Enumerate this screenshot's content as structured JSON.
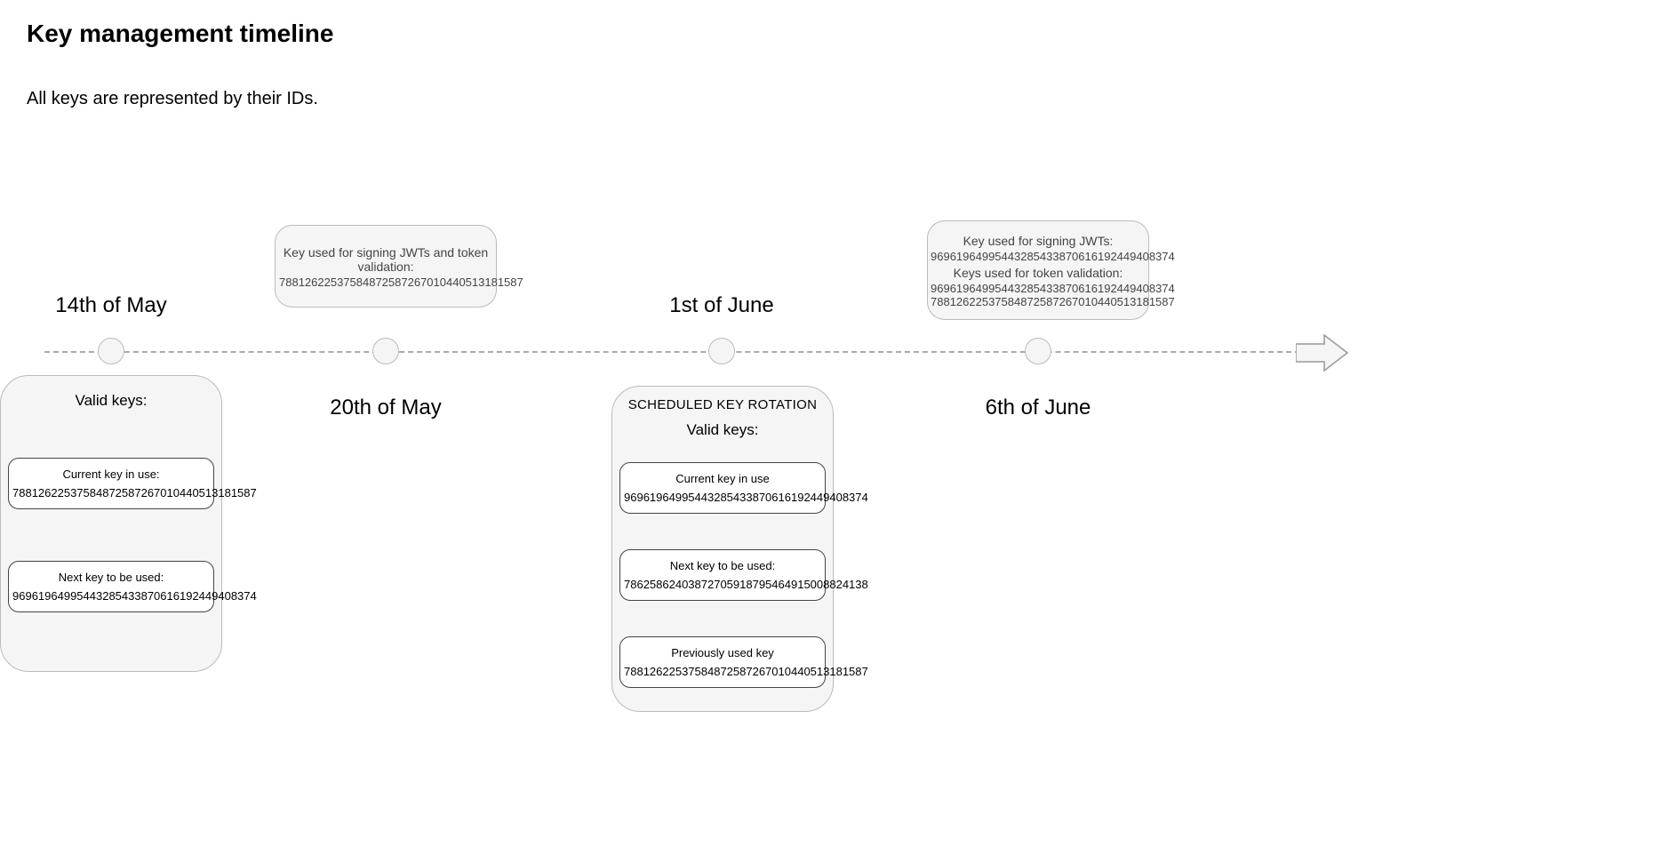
{
  "title": "Key management timeline",
  "subtitle": "All keys are represented by their IDs.",
  "dates": {
    "may14": "14th of May",
    "may20": "20th of May",
    "june1": "1st of June",
    "june6": "6th of June"
  },
  "card_may20": {
    "label": "Key used for signing JWTs and token validation:",
    "value": "78812622537584872587267010440513181587"
  },
  "card_june6": {
    "label1": "Key used for signing JWTs:",
    "value1": "96961964995443285433870616192449408374",
    "label2": "Keys used for token validation:",
    "value2": "96961964995443285433870616192449408374",
    "value3": "78812622537584872587267010440513181587"
  },
  "big_may14": {
    "heading": "Valid keys:",
    "current_label": "Current key in use:",
    "current_value": "78812622537584872587267010440513181587",
    "next_label": "Next key to be used:",
    "next_value": "96961964995443285433870616192449408374"
  },
  "big_june1": {
    "top_label": "SCHEDULED KEY ROTATION",
    "heading": "Valid keys:",
    "current_label": "Current key in use",
    "current_value": "96961964995443285433870616192449408374",
    "next_label": "Next key to be used:",
    "next_value": "78625862403872705918795464915008824138",
    "prev_label": "Previously used key",
    "prev_value": "78812622537584872587267010440513181587"
  }
}
